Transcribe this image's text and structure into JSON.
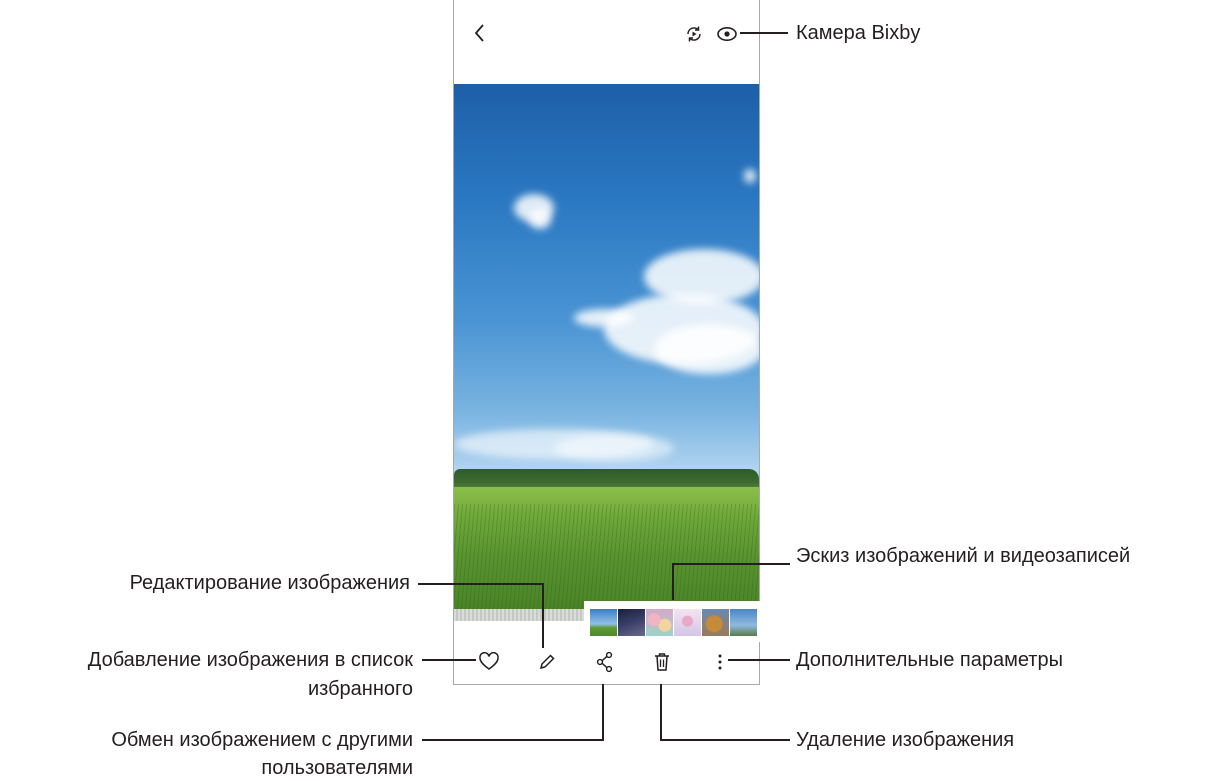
{
  "screen": {
    "top_bar": {
      "back_icon": "chevron-left-icon",
      "remaster_icon": "remaster-icon",
      "bixby_vision_icon": "eye-icon"
    },
    "bottom_bar": {
      "favorite_icon": "heart-icon",
      "edit_icon": "pencil-icon",
      "share_icon": "share-icon",
      "delete_icon": "trash-icon",
      "more_icon": "more-vertical-icon"
    },
    "thumbnails": [
      "sky-field",
      "night-sky",
      "macarons",
      "flowers",
      "cake",
      "eiffel-tower"
    ]
  },
  "callouts": {
    "bixby_vision": "Камера Bixby",
    "thumbnails": "Эскиз изображений и видеозаписей",
    "edit": "Редактирование изображения",
    "favorite_line1": "Добавление изображения в список",
    "favorite_line2": "избранного",
    "more_options": "Дополнительные параметры",
    "share_line1": "Обмен изображением с другими",
    "share_line2": "пользователями",
    "delete": "Удаление изображения"
  },
  "colors": {
    "text": "#231f20",
    "frame": "#a7a9ac",
    "sky": "#2b78c2",
    "grass": "#6ea93a"
  }
}
